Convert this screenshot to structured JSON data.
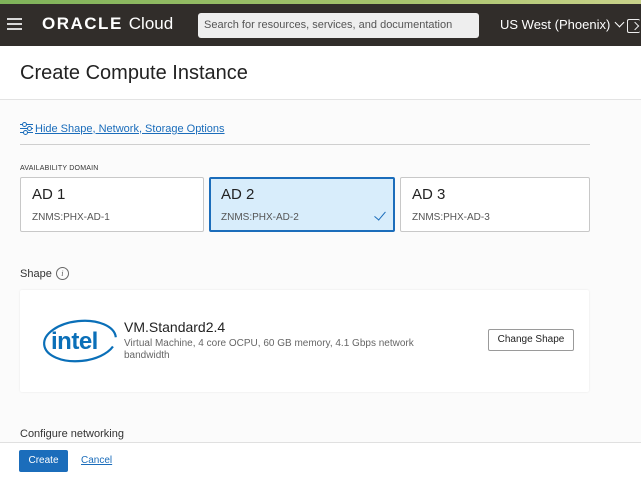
{
  "topbar": {
    "brand_oracle": "ORACLE",
    "brand_cloud": "Cloud",
    "search_placeholder": "Search for resources, services, and documentation",
    "region": "US West (Phoenix)"
  },
  "page": {
    "title": "Create Compute Instance",
    "toggle_link": "Hide Shape, Network, Storage Options"
  },
  "availability_domain": {
    "label": "AVAILABILITY DOMAIN",
    "items": [
      {
        "name": "AD 1",
        "sub": "ZNMS:PHX-AD-1",
        "selected": false
      },
      {
        "name": "AD 2",
        "sub": "ZNMS:PHX-AD-2",
        "selected": true
      },
      {
        "name": "AD 3",
        "sub": "ZNMS:PHX-AD-3",
        "selected": false
      }
    ]
  },
  "shape": {
    "label": "Shape",
    "logo_text": "intel",
    "name": "VM.Standard2.4",
    "description": "Virtual Machine, 4 core OCPU, 60 GB memory, 4.1 Gbps network bandwidth",
    "change_button": "Change Shape"
  },
  "networking": {
    "label": "Configure networking"
  },
  "footer": {
    "create": "Create",
    "cancel": "Cancel"
  },
  "colors": {
    "accent": "#1b6dbb",
    "topbar": "#312d2a",
    "selected_bg": "#d8edfb"
  }
}
